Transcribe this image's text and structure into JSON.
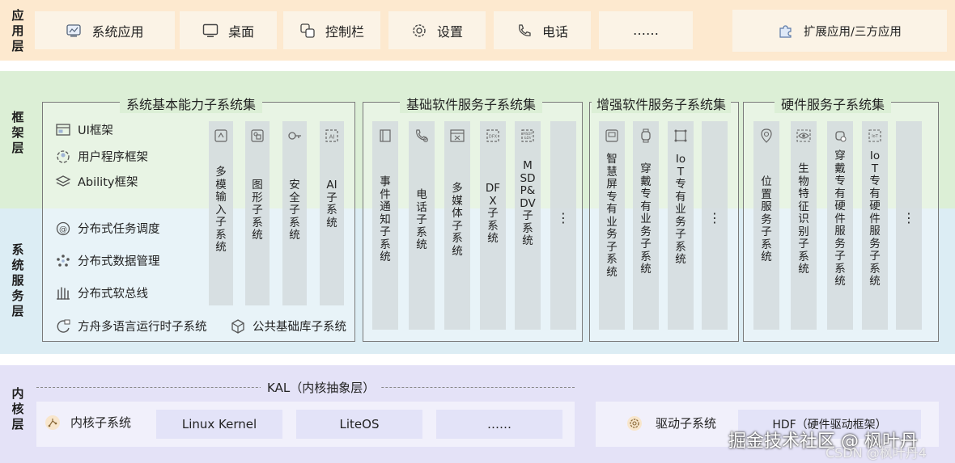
{
  "colors": {
    "app_band": "#fde9cf",
    "framework_band": "#dcefd6",
    "service_band": "#dcedf4",
    "kernel_band": "#e4e2f7",
    "pill": "#fbf3e6",
    "column": "#d4dbde",
    "kernel_box": "#e3e3f8"
  },
  "layers": {
    "app": "应用层",
    "framework": "框架层",
    "service": "系统服务层",
    "kernel": "内核层"
  },
  "app_layer": {
    "items": [
      {
        "label": "系统应用",
        "icon": "system-app-icon"
      },
      {
        "label": "桌面",
        "icon": "monitor-icon"
      },
      {
        "label": "控制栏",
        "icon": "control-bar-icon"
      },
      {
        "label": "设置",
        "icon": "gear-icon"
      },
      {
        "label": "电话",
        "icon": "phone-icon"
      },
      {
        "label": "……",
        "icon": ""
      }
    ],
    "extension": {
      "label": "扩展应用/三方应用",
      "icon": "puzzle-icon"
    }
  },
  "groups": {
    "basic": {
      "title": "系统基本能力子系统集",
      "features": [
        {
          "label": "UI框架",
          "icon": "ui-framework-icon"
        },
        {
          "label": "用户程序框架",
          "icon": "user-program-icon"
        },
        {
          "label": "Ability框架",
          "icon": "layers-icon"
        },
        {
          "label": "分布式任务调度",
          "icon": "distributed-task-icon"
        },
        {
          "label": "分布式数据管理",
          "icon": "distributed-data-icon"
        },
        {
          "label": "分布式软总线",
          "icon": "soft-bus-icon"
        },
        {
          "label": "方舟多语言运行时子系统",
          "icon": "ark-runtime-icon"
        },
        {
          "label": "公共基础库子系统",
          "icon": "cube-icon"
        }
      ],
      "columns": [
        {
          "label": "多模输入子系统",
          "icon": "input-icon"
        },
        {
          "label": "图形子系统",
          "icon": "graphics-icon"
        },
        {
          "label": "安全子系统",
          "icon": "key-icon"
        },
        {
          "label": "AI子系统",
          "icon": "ai-icon"
        }
      ]
    },
    "software": {
      "title": "基础软件服务子系统集",
      "columns": [
        {
          "label": "事件通知子系统",
          "icon": "notification-icon"
        },
        {
          "label": "电话子系统",
          "icon": "telephony-icon"
        },
        {
          "label": "多媒体子系统",
          "icon": "film-icon"
        },
        {
          "label": "DFX子系统",
          "icon": "dfx-icon"
        },
        {
          "label": "MSDP&DV子系统",
          "icon": "msdp-icon"
        },
        {
          "label": "⋮",
          "icon": ""
        }
      ]
    },
    "enhanced": {
      "title": "增强软件服务子系统集",
      "columns": [
        {
          "label": "智慧屏专有业务子系统",
          "icon": "smart-screen-icon"
        },
        {
          "label": "穿戴专有业务子系统",
          "icon": "watch-icon"
        },
        {
          "label": "IoT专有业务子系统",
          "icon": "iot-icon"
        },
        {
          "label": "⋮",
          "icon": ""
        }
      ]
    },
    "hardware": {
      "title": "硬件服务子系统集",
      "columns": [
        {
          "label": "位置服务子系统",
          "icon": "location-icon"
        },
        {
          "label": "生物特征识别子系统",
          "icon": "eye-icon"
        },
        {
          "label": "穿戴专有硬件服务子系统",
          "icon": "wearable-hw-icon"
        },
        {
          "label": "IoT专有硬件服务子系统",
          "icon": "iot-hw-icon"
        },
        {
          "label": "⋮",
          "icon": ""
        }
      ]
    }
  },
  "kernel_layer": {
    "kal": "KAL（内核抽象层）",
    "kernel_subsystem": {
      "label": "内核子系统",
      "icon": "kernel-icon"
    },
    "kernels": [
      "Linux Kernel",
      "LiteOS",
      "……"
    ],
    "driver": {
      "label": "驱动子系统",
      "icon": "driver-gear-icon"
    },
    "hdf": "HDF（硬件驱动框架）"
  },
  "watermark": {
    "main": "掘金技术社区 @ 枫叶丹",
    "sub": "CSDN @枫叶丹4"
  }
}
